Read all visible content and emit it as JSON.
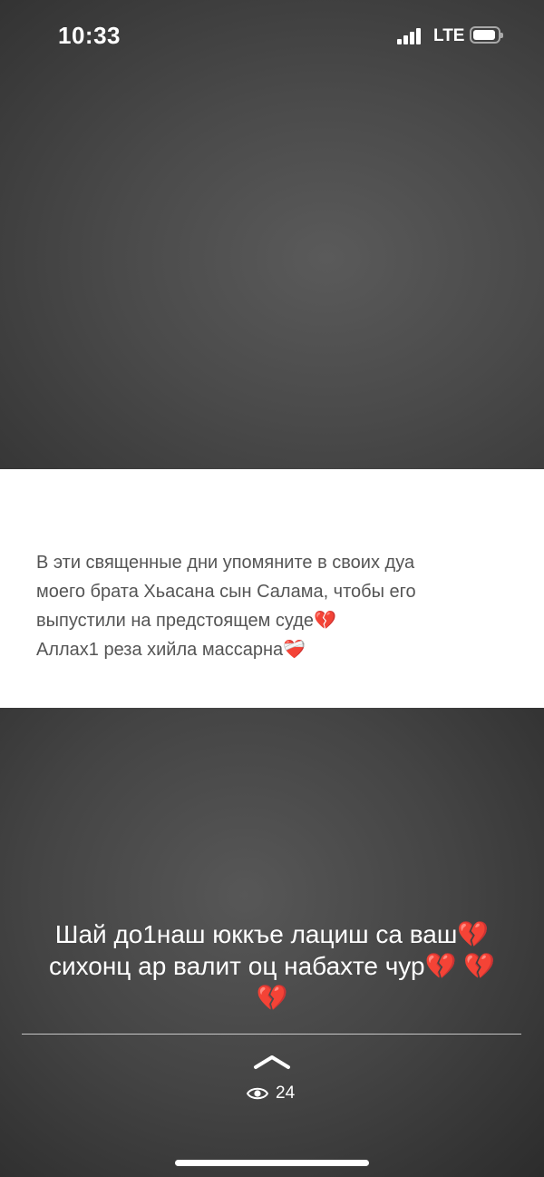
{
  "status_bar": {
    "time": "10:33",
    "network": "LTE"
  },
  "story": {
    "text_lines": [
      "В эти священные дни упомяните в своих дуа",
      "моего брата Хьасана сын Салама, чтобы его",
      "выпустили на предстоящем суде💔",
      "Аллах1 реза хийла массарна❤️‍🩹"
    ],
    "caption_lines": [
      "Шай до1наш юккъе лациш са ваш💔",
      "сихонц ар валит оц набахте чур💔 💔",
      "💔"
    ]
  },
  "footer": {
    "views_icon": "eye-icon",
    "expand_icon": "chevron-up-icon",
    "view_count": "24"
  },
  "colors": {
    "text_card_bg": "#ffffff",
    "post_text": "#555555",
    "background": "#3a3a3a"
  }
}
